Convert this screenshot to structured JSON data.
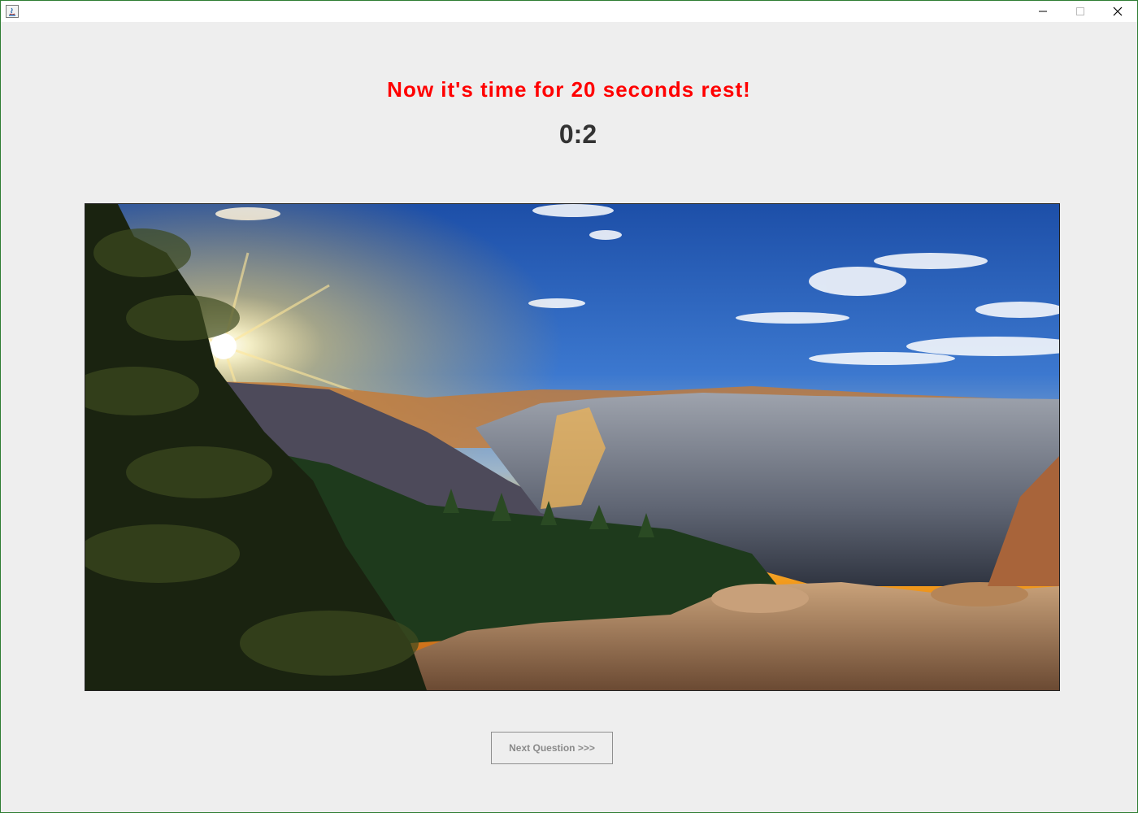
{
  "window": {
    "controls": {
      "minimize_icon": "minimize-icon",
      "maximize_icon": "maximize-icon",
      "close_icon": "close-icon"
    }
  },
  "main": {
    "headline": "Now it's time for 20 seconds rest!",
    "timer": "0:2",
    "next_button_label": "Next Question >>>",
    "next_button_enabled": false
  },
  "colors": {
    "headline": "#ff0000",
    "timer": "#333333",
    "background": "#eeeeee",
    "disabled_text": "#8a8a8a"
  }
}
